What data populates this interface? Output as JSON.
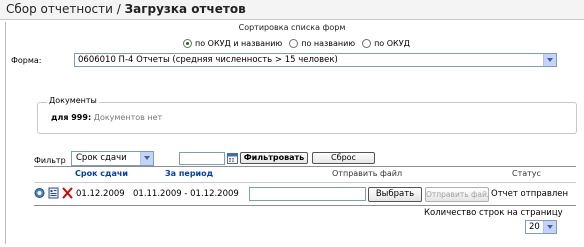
{
  "header": {
    "section": "Сбор отчетности",
    "separator": " / ",
    "page": "Загрузка отчетов"
  },
  "sort": {
    "title": "Сортировка списка форм",
    "options": [
      {
        "label": "по ОКУД и названию",
        "selected": true
      },
      {
        "label": "по названию",
        "selected": false
      },
      {
        "label": "по ОКУД",
        "selected": false
      }
    ]
  },
  "form": {
    "label": "Форма:",
    "selected": "0606010 П-4 Отчеты (средняя численность > 15 человек)"
  },
  "documents": {
    "legend": "Документы",
    "for_label": "для 999:",
    "empty_text": "Документов нет"
  },
  "filter": {
    "label": "Фильтр",
    "selected": "Срок сдачи",
    "date_value": "",
    "apply_label": "Фильтровать",
    "reset_label": "Сброс"
  },
  "table": {
    "columns": {
      "deadline": "Срок сдачи",
      "period": "За период",
      "send_file": "Отправить файл",
      "status": "Статус"
    },
    "rows": [
      {
        "deadline": "01.12.2009",
        "period": "01.11.2009 - 01.12.2009",
        "file_value": "",
        "choose_label": "Выбрать",
        "send_label": "Отправить файл",
        "status": "Отчет отправлен"
      }
    ]
  },
  "pagination": {
    "rows_label": "Количество строк на страницу",
    "rows_value": "20"
  },
  "colors": {
    "link": "#003fa8",
    "radio_selected": "#1b6e1b",
    "dropdown_button": "#c3d3fd",
    "delete_icon": "#d40000"
  }
}
